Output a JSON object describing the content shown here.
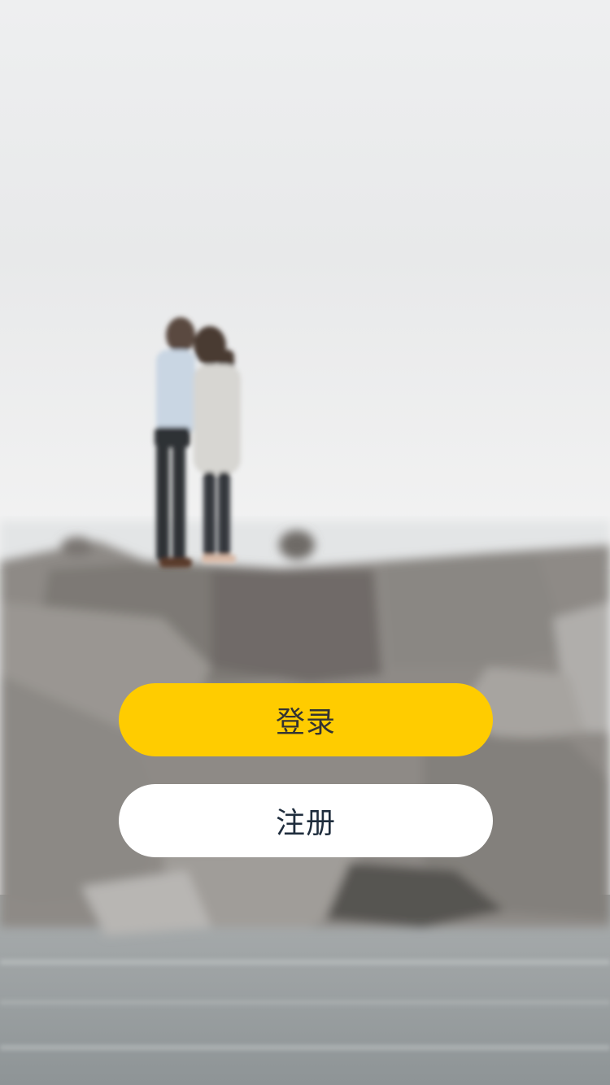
{
  "background": {
    "description_icon": "couple-on-rocks-photo",
    "sky_color": "#ecedee",
    "rock_color": "#8f8c88",
    "water_color": "#9fa4a6"
  },
  "actions": {
    "login_label": "登录",
    "register_label": "注册"
  },
  "colors": {
    "accent": "#ffcc00",
    "secondary_button": "#ffffff",
    "login_text": "#333333",
    "register_text": "#1f2d3d"
  }
}
